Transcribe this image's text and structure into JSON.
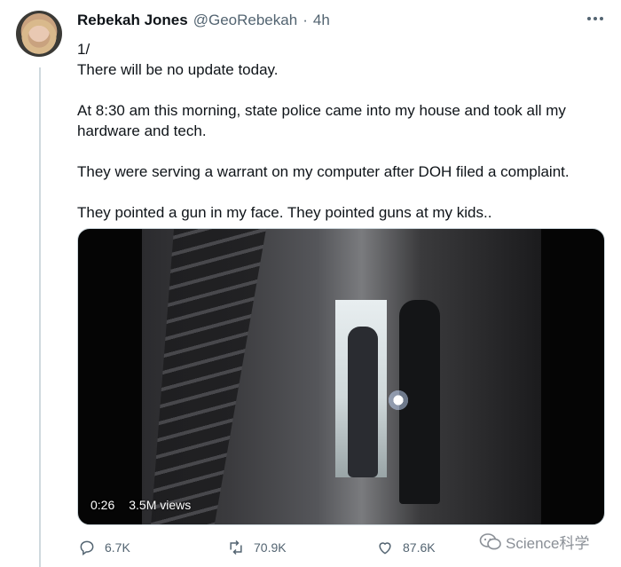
{
  "tweet": {
    "author_name": "Rebekah Jones",
    "handle": "@GeoRebekah",
    "separator": "·",
    "time": "4h",
    "lines": [
      "1/",
      "There will be no update today.",
      "",
      "At 8:30 am this morning, state police came into my house and took all my",
      "hardware and tech.",
      "",
      "They were serving a warrant on my computer after DOH filed a complaint.",
      "",
      "They pointed a gun in my face.  They pointed guns at my kids.."
    ]
  },
  "video": {
    "duration": "0:26",
    "views": "3.5M views"
  },
  "actions": {
    "replies": "6.7K",
    "retweets": "70.9K",
    "likes": "87.6K"
  },
  "watermark": {
    "text": "Science科学"
  },
  "icons": [
    "more-icon",
    "reply-icon",
    "retweet-icon",
    "like-icon",
    "wechat-icon"
  ],
  "colors": {
    "secondary_text": "#536471",
    "primary_text": "#0f1419",
    "thread_line": "#cfd9de"
  }
}
